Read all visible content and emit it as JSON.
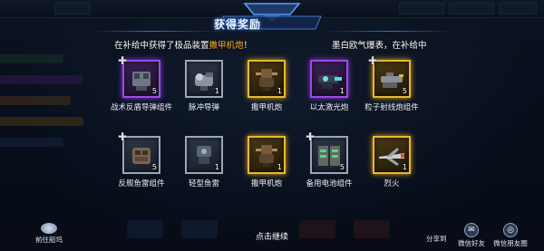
{
  "title": "获得奖励",
  "announcements": {
    "left_prefix": "在补给中获得了极品装置",
    "left_highlight": "撒甲机炮",
    "left_suffix": "！",
    "right": "墨白欧气爆表，在补给中"
  },
  "items": [
    {
      "name": "战术反盾导弹组件",
      "qty": "5",
      "rarity": "purple",
      "fragment": true,
      "icon": "missile-launcher-icon"
    },
    {
      "name": "脉冲导弹",
      "qty": "1",
      "rarity": "white",
      "fragment": false,
      "icon": "pulse-missile-icon"
    },
    {
      "name": "撒甲机炮",
      "qty": "1",
      "rarity": "gold",
      "fragment": false,
      "icon": "gatling-cannon-icon"
    },
    {
      "name": "以太激光炮",
      "qty": "1",
      "rarity": "purple",
      "fragment": false,
      "icon": "ether-laser-cannon-icon"
    },
    {
      "name": "粒子射线炮组件",
      "qty": "5",
      "rarity": "gold",
      "fragment": true,
      "icon": "particle-beam-icon"
    },
    {
      "name": "反舰鱼雷组件",
      "qty": "5",
      "rarity": "white",
      "fragment": true,
      "icon": "torpedo-launcher-icon"
    },
    {
      "name": "轻型鱼雷",
      "qty": "1",
      "rarity": "white",
      "fragment": false,
      "icon": "light-torpedo-icon"
    },
    {
      "name": "撒甲机炮",
      "qty": "1",
      "rarity": "gold",
      "fragment": false,
      "icon": "gatling-cannon-icon"
    },
    {
      "name": "备用电池组件",
      "qty": "5",
      "rarity": "white",
      "fragment": true,
      "icon": "battery-pack-icon"
    },
    {
      "name": "烈火",
      "qty": "1",
      "rarity": "gold",
      "fragment": false,
      "icon": "fighter-ship-icon"
    }
  ],
  "bottom": {
    "continue": "点击继续",
    "ship_label": "前往船坞",
    "share_label": "分享到",
    "wechat_friend": "微信好友",
    "wechat_moments": "微信朋友圈"
  },
  "colors": {
    "purple": "#a04ae6",
    "gold": "#e8b92a",
    "white": "#9aa7b8",
    "highlight": "#ffae2a",
    "title_glow": "#4a90ff"
  }
}
